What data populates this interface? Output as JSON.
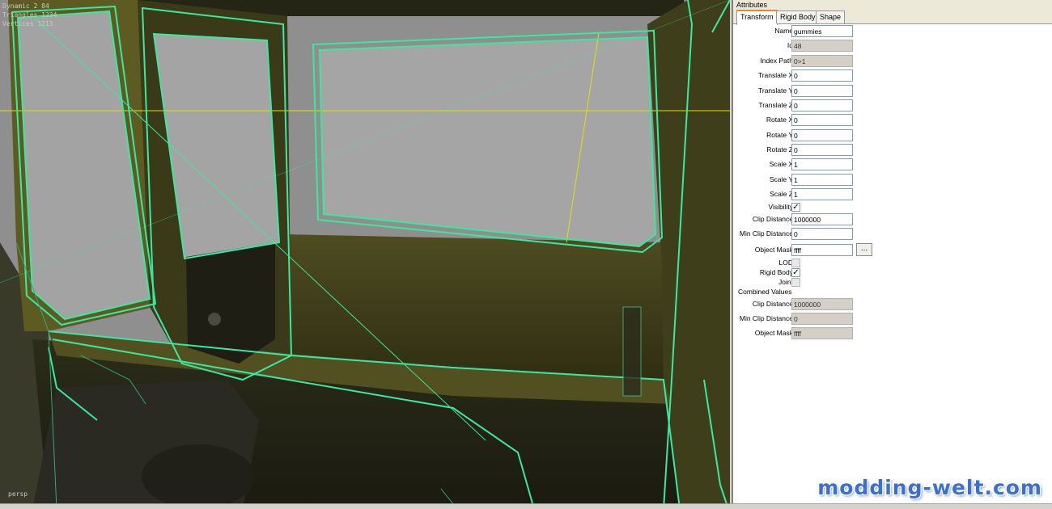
{
  "viewport": {
    "stats": [
      "Dynamic 2 84",
      "Triangles 1234",
      "Vertices 1213"
    ],
    "camera": "persp"
  },
  "panel": {
    "title": "Attributes",
    "tabs": [
      {
        "label": "Transform",
        "active": true
      },
      {
        "label": "Rigid Body",
        "active": false
      },
      {
        "label": "Shape",
        "active": false
      }
    ],
    "fields": {
      "name": {
        "label": "Name",
        "value": "gummies"
      },
      "id": {
        "label": "Id",
        "value": "48"
      },
      "index_path": {
        "label": "Index Path",
        "value": "0>1"
      },
      "translate_x": {
        "label": "Translate X",
        "value": "0"
      },
      "translate_y": {
        "label": "Translate Y",
        "value": "0"
      },
      "translate_z": {
        "label": "Translate Z",
        "value": "0"
      },
      "rotate_x": {
        "label": "Rotate X",
        "value": "0"
      },
      "rotate_y": {
        "label": "Rotate Y",
        "value": "0"
      },
      "rotate_z": {
        "label": "Rotate Z",
        "value": "0"
      },
      "scale_x": {
        "label": "Scale X",
        "value": "1"
      },
      "scale_y": {
        "label": "Scale Y",
        "value": "1"
      },
      "scale_z": {
        "label": "Scale Z",
        "value": "1"
      },
      "visibility": {
        "label": "Visibility",
        "checked": true
      },
      "clip_distance": {
        "label": "Clip Distance",
        "value": "1000000"
      },
      "min_clip_distance": {
        "label": "Min Clip Distance",
        "value": "0"
      },
      "object_mask": {
        "label": "Object Mask",
        "value": "ffff",
        "button": "..."
      },
      "lod": {
        "label": "LOD",
        "checked": false
      },
      "rigid_body": {
        "label": "Rigid Body",
        "checked": true
      },
      "joint": {
        "label": "Joint",
        "checked": false
      }
    },
    "combined": {
      "title": "Combined Values",
      "clip_distance": {
        "label": "Clip Distance",
        "value": "1000000"
      },
      "min_clip_distance": {
        "label": "Min Clip Distance",
        "value": "0"
      },
      "object_mask": {
        "label": "Object Mask",
        "value": "ffff"
      }
    }
  },
  "watermark": "modding-welt.com",
  "colors": {
    "wireframe": "#3be8a0",
    "grid_axis": "#e6e000",
    "viewport_bg": "#8f8f8f",
    "cab_body": "#6b6a2a",
    "watermark": "#3d6fd0"
  }
}
